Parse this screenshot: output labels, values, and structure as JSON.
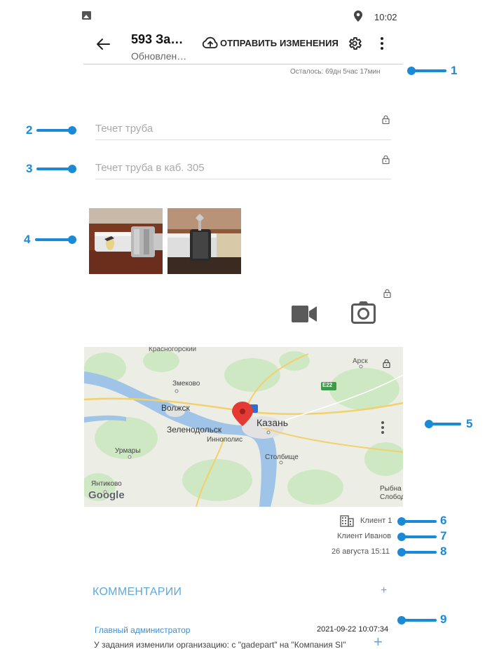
{
  "status_bar": {
    "time": "10:02"
  },
  "toolbar": {
    "title": "593 За…",
    "subtitle": "Обновлен…",
    "send_label": "ОТПРАВИТЬ ИЗМЕНЕНИЯ",
    "time_left": "Осталось: 69дн 5час 17мин"
  },
  "fields": {
    "name": "Течет труба",
    "description": "Течет труба в каб. 305"
  },
  "map": {
    "labels": {
      "krasnogorsky": "Красногорский",
      "arsk": "Арск",
      "zmeyevo": "Змеково",
      "road": "E22",
      "volzhsk": "Волжск",
      "kazan": "Казань",
      "zelenodolsk": "Зеленодольск",
      "innopolis": "Иннополис",
      "urmary": "Урмары",
      "stolbishche": "Столбище",
      "yantikovo": "Янтиково",
      "rybnaya": "Рыбна",
      "sloboda": "Слобод",
      "google": "Google"
    }
  },
  "info": {
    "client": "Клиент 1",
    "contact": "Клиент Иванов",
    "date": "26 августа 15:11"
  },
  "comments": {
    "title": "КОММЕНТАРИИ",
    "plus": "+",
    "items": [
      {
        "author": "Главный администратор",
        "date": "2021-09-22 10:07:34",
        "text": "У задания изменили организацию: с \"gadepart\" на \"Компания SI\""
      }
    ],
    "add": "+"
  },
  "annotations": [
    "1",
    "2",
    "3",
    "4",
    "5",
    "6",
    "7",
    "8",
    "9"
  ],
  "colors": {
    "accent": "#1a8ad6",
    "link": "#3b8fd6",
    "comments": "#5aa9e0",
    "pin": "#e53935"
  }
}
